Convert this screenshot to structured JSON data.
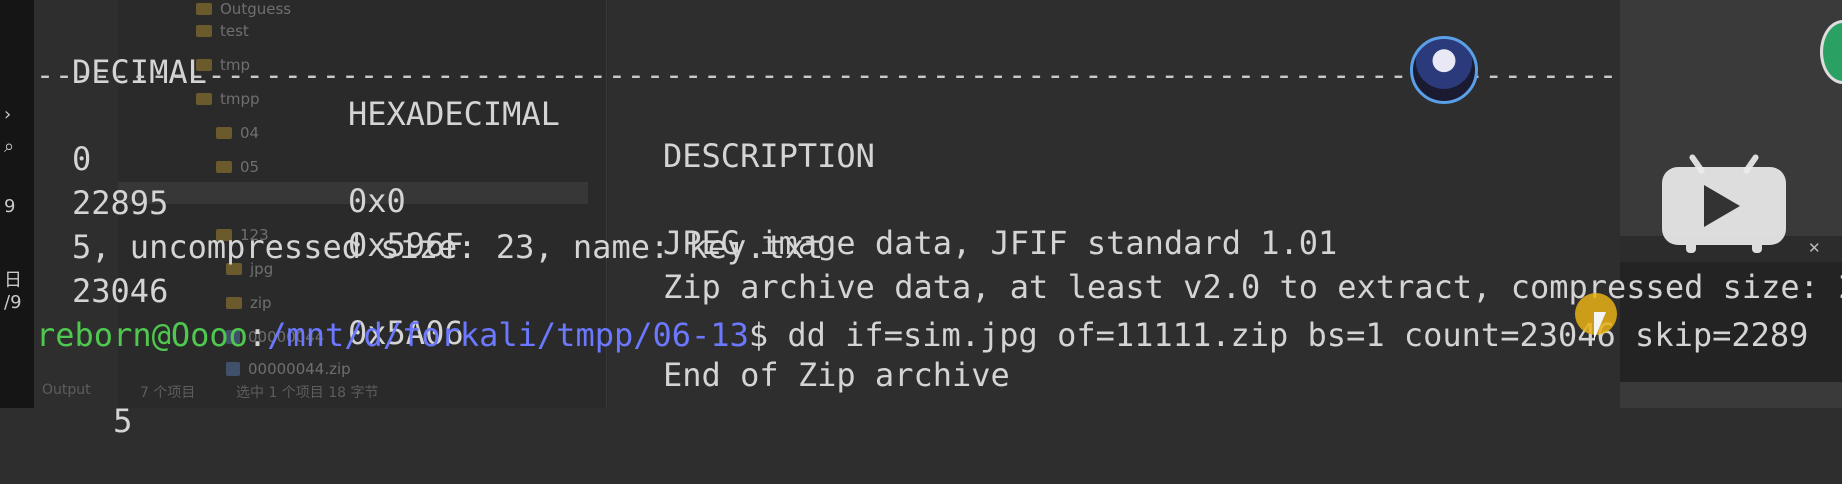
{
  "desktop": {
    "icons": [
      "›",
      "⌕",
      "9",
      "日",
      "/9"
    ]
  },
  "explorer": {
    "folders": [
      "Outguess",
      "test",
      "tmp",
      "tmpp",
      "04",
      "05",
      "123",
      "jpg",
      "zip"
    ],
    "files": [
      "00000044",
      "00000044.zip"
    ],
    "status_left": "7 个项目",
    "status_mid": "选中 1 个项目  18 字节",
    "faint_left": "Output"
  },
  "terminal": {
    "header": {
      "decimal": "DECIMAL",
      "hex": "HEXADECIMAL",
      "description": "DESCRIPTION"
    },
    "separator": "--------------------------------------------------------------------------------------------------------",
    "rows": [
      {
        "decimal": "0",
        "hex": "0x0",
        "description": "JPEG image data, JFIF standard 1.01"
      },
      {
        "decimal": "22895",
        "hex": "0x596F",
        "description": "Zip archive data, at least v2.0 to extract, compressed size: 2"
      },
      {
        "wrap": "5, uncompressed size: 23, name: key.txt"
      },
      {
        "decimal": "23046",
        "hex": "0x5A06",
        "description": "End of Zip archive"
      }
    ],
    "prompt": {
      "user_host": "reborn@Oooo",
      "colon": ":",
      "path": "/mnt/d/forkali/tmpp/06-13",
      "dollar": "$",
      "command": " dd if=sim.jpg of=11111.zip bs=1 count=23046 skip=2289",
      "wrap": "5"
    }
  },
  "colors": {
    "background": "#2e2e2e",
    "text": "#d4d4d4",
    "prompt_user": "#4ec84e",
    "prompt_path": "#6b78ff"
  },
  "overlays": {
    "avatar_icon": "avatar-icon",
    "play_icon": "play-button-icon",
    "close_glyph": "✕"
  }
}
